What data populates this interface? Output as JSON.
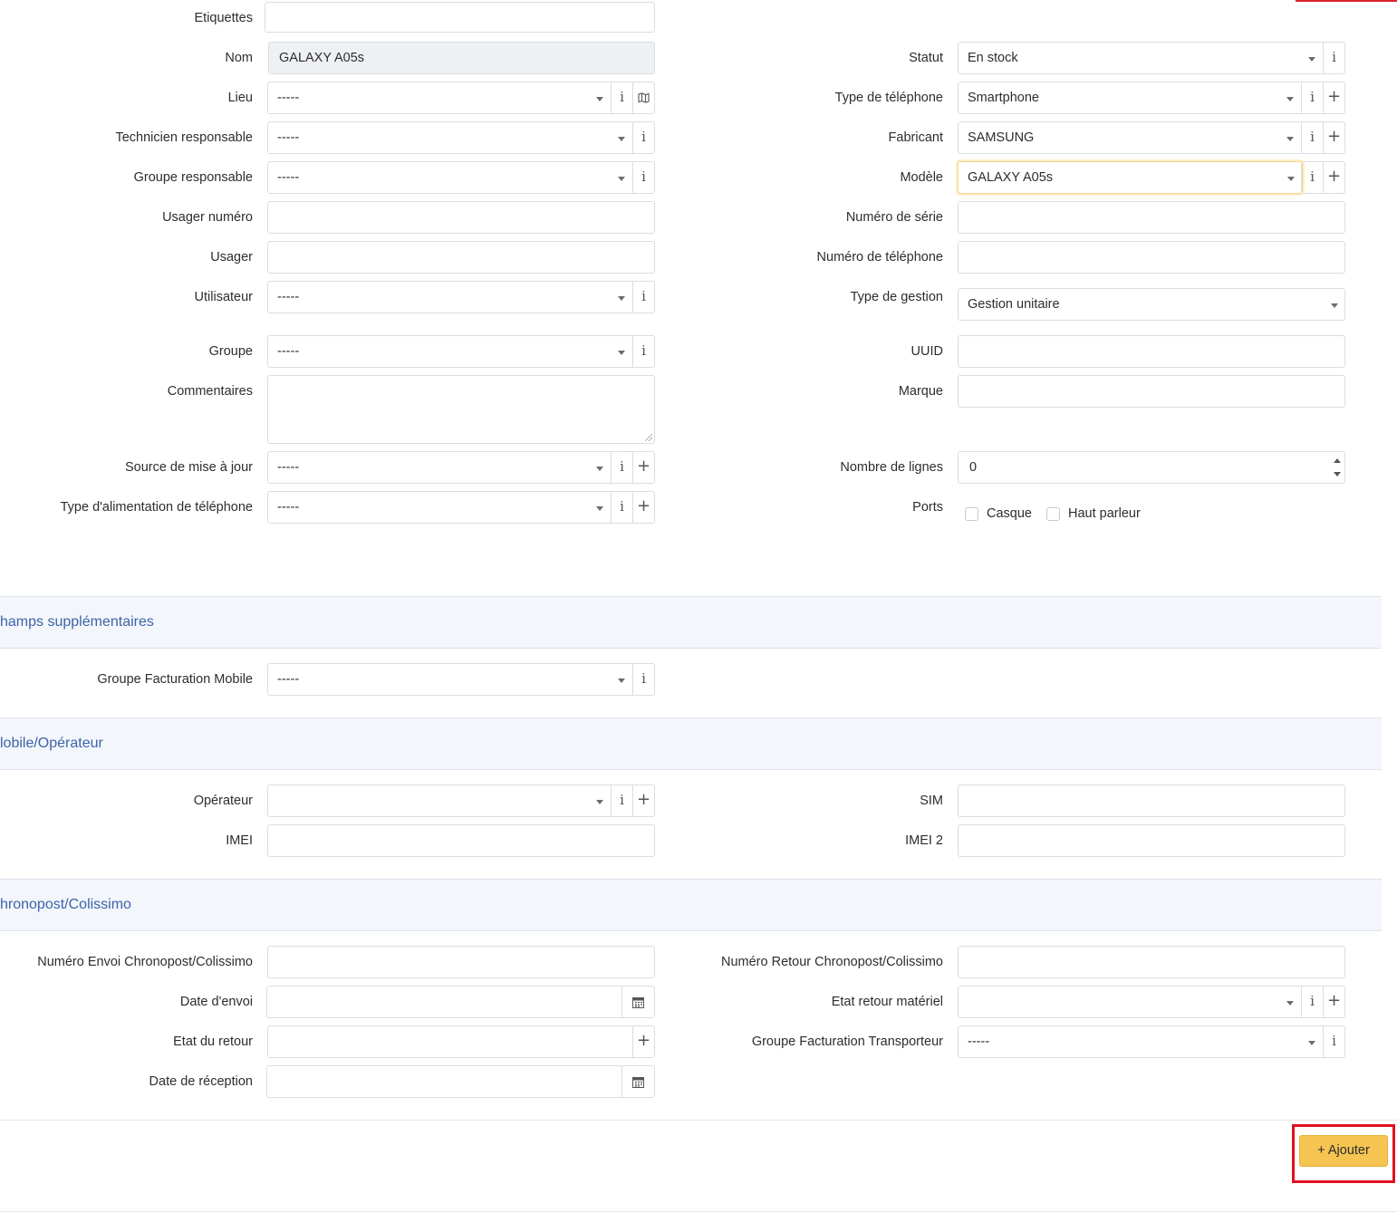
{
  "form": {
    "etiquettes": {
      "label": "Etiquettes",
      "value": ""
    },
    "nom": {
      "label": "Nom",
      "value": "GALAXY A05s"
    },
    "lieu": {
      "label": "Lieu",
      "value": "-----"
    },
    "technicien": {
      "label": "Technicien responsable",
      "value": "-----"
    },
    "groupe_responsable": {
      "label": "Groupe responsable",
      "value": "-----"
    },
    "usager_numero": {
      "label": "Usager numéro",
      "value": ""
    },
    "usager": {
      "label": "Usager",
      "value": ""
    },
    "utilisateur": {
      "label": "Utilisateur",
      "value": "-----"
    },
    "groupe": {
      "label": "Groupe",
      "value": "-----"
    },
    "commentaires": {
      "label": "Commentaires",
      "value": ""
    },
    "source_maj": {
      "label": "Source de mise à jour",
      "value": "-----"
    },
    "type_alimentation": {
      "label": "Type d'alimentation de téléphone",
      "value": "-----"
    },
    "statut": {
      "label": "Statut",
      "value": "En stock"
    },
    "type_telephone": {
      "label": "Type de téléphone",
      "value": "Smartphone"
    },
    "fabricant": {
      "label": "Fabricant",
      "value": "SAMSUNG"
    },
    "modele": {
      "label": "Modèle",
      "value": "GALAXY A05s"
    },
    "numero_serie": {
      "label": "Numéro de série",
      "value": ""
    },
    "numero_telephone": {
      "label": "Numéro de téléphone",
      "value": ""
    },
    "type_gestion": {
      "label": "Type de gestion",
      "value": "Gestion unitaire"
    },
    "uuid": {
      "label": "UUID",
      "value": ""
    },
    "marque": {
      "label": "Marque",
      "value": ""
    },
    "nombre_lignes": {
      "label": "Nombre de lignes",
      "value": "0"
    },
    "ports": {
      "label": "Ports",
      "casque": "Casque",
      "haut_parleur": "Haut parleur"
    }
  },
  "sections": {
    "champs": {
      "title": "hamps supplémentaires",
      "groupe_facturation_mobile": {
        "label": "Groupe Facturation Mobile",
        "value": "-----"
      }
    },
    "mobile": {
      "title": "lobile/Opérateur",
      "operateur": {
        "label": "Opérateur",
        "value": ""
      },
      "imei": {
        "label": "IMEI",
        "value": ""
      },
      "sim": {
        "label": "SIM",
        "value": ""
      },
      "imei2": {
        "label": "IMEI 2",
        "value": ""
      }
    },
    "chrono": {
      "title": "hronopost/Colissimo",
      "numero_envoi": {
        "label": "Numéro Envoi Chronopost/Colissimo",
        "value": ""
      },
      "date_envoi": {
        "label": "Date d'envoi",
        "value": ""
      },
      "etat_retour": {
        "label": "Etat du retour",
        "value": ""
      },
      "date_reception": {
        "label": "Date de réception",
        "value": ""
      },
      "numero_retour": {
        "label": "Numéro Retour Chronopost/Colissimo",
        "value": ""
      },
      "etat_retour_materiel": {
        "label": "Etat retour matériel",
        "value": ""
      },
      "groupe_facturation_transporteur": {
        "label": "Groupe Facturation Transporteur",
        "value": "-----"
      }
    }
  },
  "actions": {
    "add_label": "+ Ajouter"
  },
  "icons": {
    "info": "i",
    "plus": "+",
    "map": "map-icon",
    "calendar": "calendar-icon"
  }
}
